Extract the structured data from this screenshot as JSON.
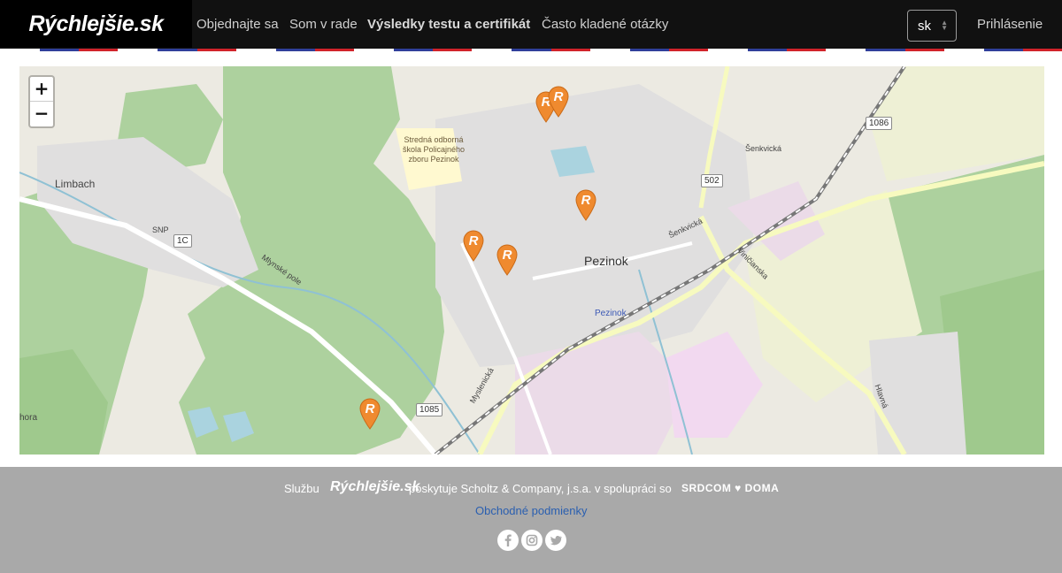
{
  "header": {
    "brand": "Rýchlejšie.sk",
    "nav": [
      {
        "label": "Objednajte sa"
      },
      {
        "label": "Som v rade"
      },
      {
        "label": "Výsledky testu a certifikát"
      },
      {
        "label": "Často kladené otázky"
      }
    ],
    "language": "sk",
    "login": "Prihlásenie"
  },
  "colors": {
    "nav_bg": "#111111",
    "brand_bg": "#000000",
    "marker": "#ef8a2f",
    "footer_bg": "#a9a9a9",
    "link": "#2a5fb0",
    "stripe_blue": "#2f3f9a",
    "stripe_red": "#d1232a"
  },
  "map": {
    "zoom_in": "+",
    "zoom_out": "−",
    "labels": {
      "town": "Pezinok",
      "station": "Pezinok",
      "village": "Limbach",
      "school": "Stredná odborná škola Policajného zboru Pezinok",
      "street_mlynske": "Mlynské pole",
      "street_snp": "SNP",
      "street_senkvicka_top": "Šenkvická",
      "street_senkvicka": "Šenkvická",
      "street_vinicianska": "Viničianska",
      "street_myslenicka": "Myslenická",
      "street_hlavna": "Hlavná",
      "hora": "hora"
    },
    "road_numbers": [
      "1086",
      "502",
      "1085",
      "1C"
    ],
    "marker_icon": "testing-site-marker-icon",
    "marker_letter": "R"
  },
  "footer": {
    "prefix": "Službu",
    "logo": "Rýchlejšie.sk",
    "middle": "poskytuje Scholtz & Company, j.s.a. v spolupráci so",
    "partner": "SRDCOM ♥ DOMA",
    "terms": "Obchodné podmienky",
    "social": [
      "facebook-icon",
      "instagram-icon",
      "twitter-icon"
    ]
  }
}
